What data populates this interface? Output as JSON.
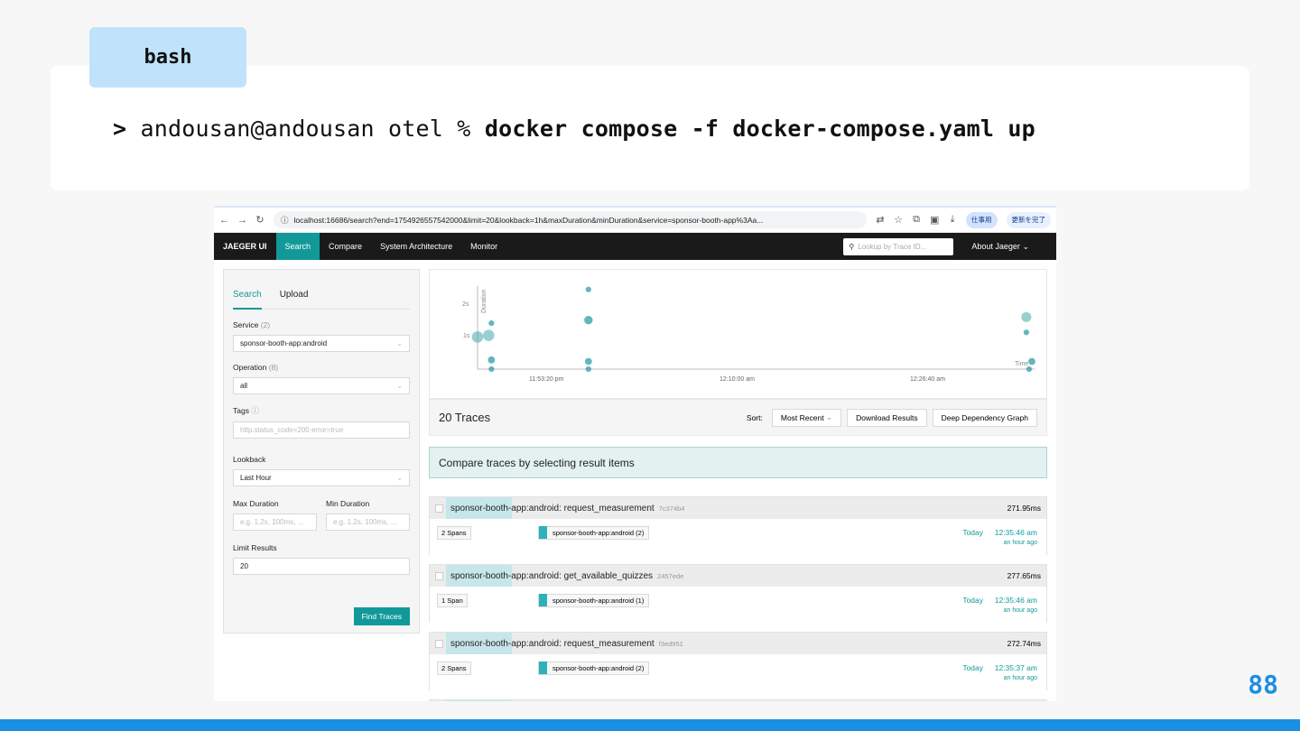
{
  "slide": {
    "tab_label": "bash",
    "prompt": ">",
    "command_prefix": "andousan@andousan otel %",
    "command": "docker compose -f docker-compose.yaml up",
    "page_number": "88"
  },
  "browser": {
    "url_host": "localhost",
    "url": "localhost:16686/search?end=1754926557542000&limit=20&lookback=1h&maxDuration&minDuration&service=sponsor-booth-app%3Aa...",
    "profile_chip": "仕事用",
    "update_chip": "更新を完了"
  },
  "jaeger": {
    "brand": "JAEGER UI",
    "nav": [
      "Search",
      "Compare",
      "System Architecture",
      "Monitor"
    ],
    "lookup_placeholder": "Lookup by Trace ID...",
    "about": "About Jaeger"
  },
  "search_panel": {
    "tabs": [
      "Search",
      "Upload"
    ],
    "service_label": "Service",
    "service_count": "(2)",
    "service_value": "sponsor-booth-app:android",
    "operation_label": "Operation",
    "operation_count": "(8)",
    "operation_value": "all",
    "tags_label": "Tags",
    "tags_placeholder": "http.status_code=200 error=true",
    "lookback_label": "Lookback",
    "lookback_value": "Last Hour",
    "max_duration_label": "Max Duration",
    "min_duration_label": "Min Duration",
    "max_duration_placeholder": "e.g. 1.2s, 100ms, ...",
    "min_duration_placeholder": "e.g. 1.2s, 100ms, ...",
    "limit_label": "Limit Results",
    "limit_value": "20",
    "find_button": "Find Traces"
  },
  "chart_data": {
    "type": "scatter",
    "ylabel": "Duration",
    "xlabel": "Time",
    "ytick_labels": [
      "2s",
      "1s"
    ],
    "xtick_labels": [
      "11:53:20 pm",
      "12:10:00 am",
      "12:26:40 am"
    ],
    "points_description": "trace durations over time",
    "points": [
      {
        "t": 0.0,
        "d": 1.05,
        "s": 3
      },
      {
        "t": 0.02,
        "d": 1.1,
        "s": 3
      },
      {
        "t": 0.025,
        "d": 1.5,
        "s": 1
      },
      {
        "t": 0.025,
        "d": 0.3,
        "s": 1.5
      },
      {
        "t": 0.025,
        "d": 0.0,
        "s": 1
      },
      {
        "t": 0.2,
        "d": 2.6,
        "s": 1
      },
      {
        "t": 0.2,
        "d": 1.6,
        "s": 2
      },
      {
        "t": 0.2,
        "d": 0.25,
        "s": 1.5
      },
      {
        "t": 0.2,
        "d": 0.0,
        "s": 1
      },
      {
        "t": 0.99,
        "d": 1.7,
        "s": 2.5
      },
      {
        "t": 0.99,
        "d": 1.2,
        "s": 1
      },
      {
        "t": 1.0,
        "d": 0.25,
        "s": 1.5
      },
      {
        "t": 0.995,
        "d": 0.0,
        "s": 1
      }
    ],
    "ylim": [
      0,
      2.8
    ],
    "xlim": [
      0,
      1
    ]
  },
  "results": {
    "count_label": "20 Traces",
    "sort_label": "Sort:",
    "sort_value": "Most Recent",
    "download_button": "Download Results",
    "ddg_button": "Deep Dependency Graph",
    "compare_banner": "Compare traces by selecting result items",
    "traces": [
      {
        "name": "sponsor-booth-app:android: request_measurement",
        "id": "7c374b4",
        "duration": "271.95ms",
        "spans": "2 Spans",
        "service": "sponsor-booth-app:android (2)",
        "day": "Today",
        "time": "12:35:46 am",
        "ago": "an hour ago"
      },
      {
        "name": "sponsor-booth-app:android: get_available_quizzes",
        "id": "2457ede",
        "duration": "277.65ms",
        "spans": "1 Span",
        "service": "sponsor-booth-app:android (1)",
        "day": "Today",
        "time": "12:35:46 am",
        "ago": "an hour ago"
      },
      {
        "name": "sponsor-booth-app:android: request_measurement",
        "id": "f3ed951",
        "duration": "272.74ms",
        "spans": "2 Spans",
        "service": "sponsor-booth-app:android (2)",
        "day": "Today",
        "time": "12:35:37 am",
        "ago": "an hour ago"
      }
    ]
  }
}
